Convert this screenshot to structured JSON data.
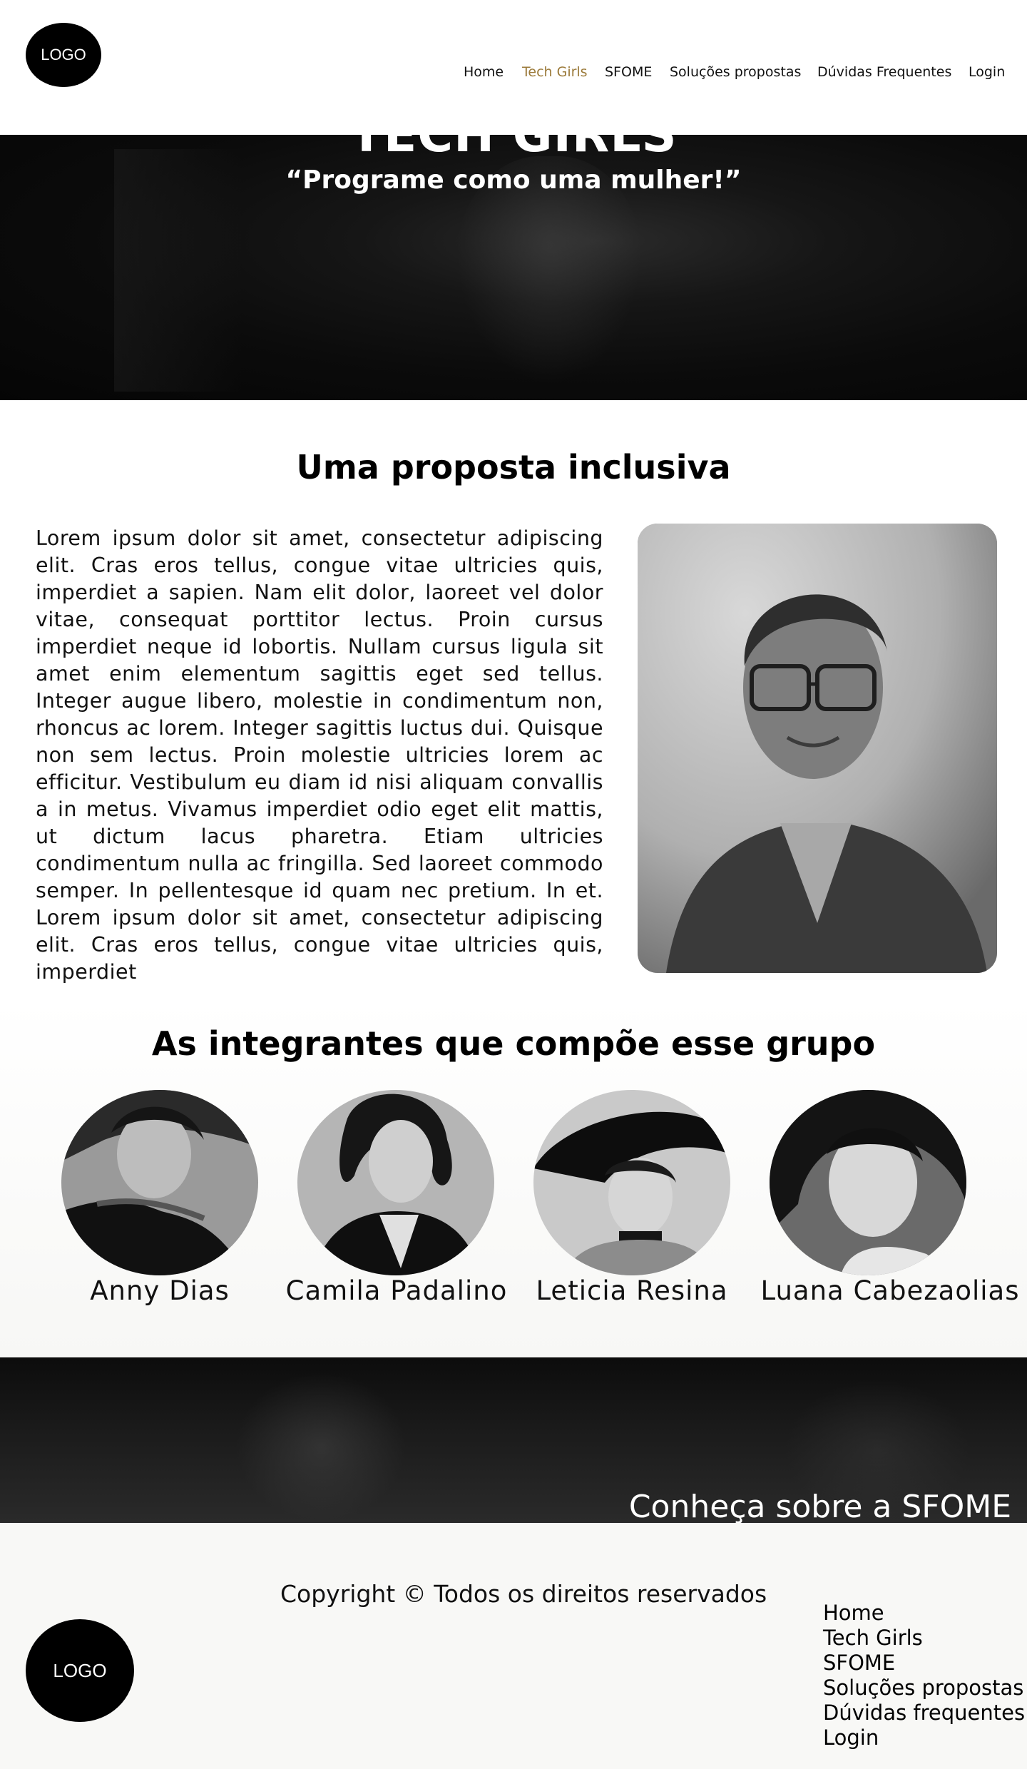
{
  "header": {
    "logo_text": "LOGO",
    "nav": [
      {
        "label": "Home",
        "active": false
      },
      {
        "label": "Tech Girls",
        "active": true
      },
      {
        "label": "SFOME",
        "active": false
      },
      {
        "label": "Soluções propostas",
        "active": false
      },
      {
        "label": "Dúvidas Frequentes",
        "active": false
      },
      {
        "label": "Login",
        "active": false
      }
    ],
    "active_color": "#9b7a3a"
  },
  "hero": {
    "title": "TECH GIRLS",
    "subtitle": "“Programe como uma mulher!”"
  },
  "about": {
    "title": "Uma proposta inclusiva",
    "text": "Lorem ipsum dolor sit amet, consectetur adipiscing elit. Cras eros tellus, congue vitae ultricies quis, imperdiet a sapien. Nam elit dolor, laoreet vel dolor vitae, consequat porttitor lectus. Proin cursus imperdiet neque id lobortis. Nullam cursus ligula sit amet enim elementum sagittis eget sed tellus. Integer augue libero, molestie in condimentum non, rhoncus ac lorem. Integer sagittis luctus dui. Quisque non sem lectus. Proin molestie ultricies lorem ac efficitur. Vestibulum eu diam id nisi aliquam convallis a in metus. Vivamus imperdiet odio eget elit mattis, ut dictum lacus pharetra. Etiam ultricies condimentum nulla ac fringilla. Sed laoreet commodo semper. In pellentesque id quam nec pretium. In et. Lorem ipsum dolor sit amet, consectetur adipiscing elit. Cras eros tellus, congue vitae ultricies quis, imperdiet"
  },
  "members": {
    "title": "As integrantes que compõe esse grupo",
    "items": [
      {
        "name": "Anny Dias"
      },
      {
        "name": "Camila Padalino"
      },
      {
        "name": "Leticia Resina"
      },
      {
        "name": "Luana Cabezaolias"
      }
    ]
  },
  "banner": {
    "link": "Conheça sobre a SFOME"
  },
  "footer": {
    "logo_text": "LOGO",
    "copyright": "Copyright © Todos os direitos reservados",
    "nav": [
      {
        "label": "Home"
      },
      {
        "label": "Tech Girls"
      },
      {
        "label": "SFOME"
      },
      {
        "label": "Soluções propostas"
      },
      {
        "label": "Dúvidas frequentes"
      },
      {
        "label": "Login"
      }
    ]
  }
}
